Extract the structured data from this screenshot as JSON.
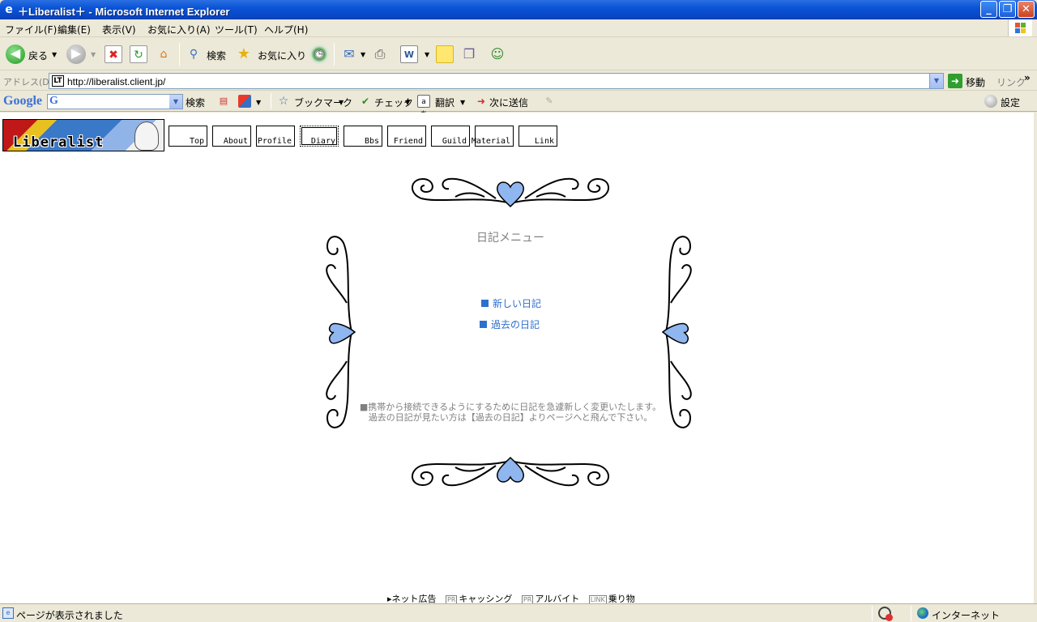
{
  "window": {
    "title": "＋Liberalist＋ - Microsoft Internet Explorer",
    "minimize": "_",
    "restore": "❐",
    "close": "✕"
  },
  "menubar": {
    "items": [
      "ファイル(F)",
      "編集(E)",
      "表示(V)",
      "お気に入り(A)",
      "ツール(T)",
      "ヘルプ(H)"
    ]
  },
  "toolbar": {
    "back_label": "戻る",
    "search_label": "検索",
    "favorites_label": "お気に入り",
    "icons": [
      "back-icon",
      "forward-icon",
      "stop-icon",
      "refresh-icon",
      "home-icon",
      "search-icon",
      "favorites-icon",
      "history-icon",
      "mail-icon",
      "print-icon",
      "edit-icon",
      "notes-icon",
      "research-icon",
      "messenger-icon"
    ]
  },
  "addressbar": {
    "label": "アドレス(D)",
    "url": "http://liberalist.client.jp/",
    "go_label": "移動",
    "links_label": "リンク",
    "links_more": "»"
  },
  "googlebar": {
    "logo": "Google",
    "search_icon_letter": "G",
    "search_button": "検索",
    "bookmark_label": "ブックマーク",
    "check_label": "チェック",
    "translate_label": "翻訳",
    "send_label": "次に送信",
    "settings_label": "設定"
  },
  "page": {
    "banner_text": "Liberalist",
    "nav": [
      "Top",
      "About",
      "Profile",
      "Diary",
      "Bbs",
      "Friend",
      "Guild",
      "Material",
      "Link"
    ],
    "active_nav": "Diary",
    "menu_title": "日記メニュー",
    "links": [
      "新しい日記",
      "過去の日記"
    ],
    "notice_line1": "■携帯から接続できるようにするために日記を急遽新しく変更いたします。",
    "notice_line2": "過去の日記が見たい方は【過去の日記】よりページへと飛んで下さい。",
    "ads": {
      "lead": "ネット広告",
      "items": [
        {
          "tag": "PR",
          "label": "キャッシング"
        },
        {
          "tag": "PR",
          "label": "アルバイト"
        },
        {
          "tag": "LINK",
          "label": "乗り物"
        }
      ]
    },
    "accent_color": "#2d6fcf",
    "heart_color": "#8fb6ef"
  },
  "statusbar": {
    "text": "ページが表示されました",
    "zone": "インターネット"
  }
}
